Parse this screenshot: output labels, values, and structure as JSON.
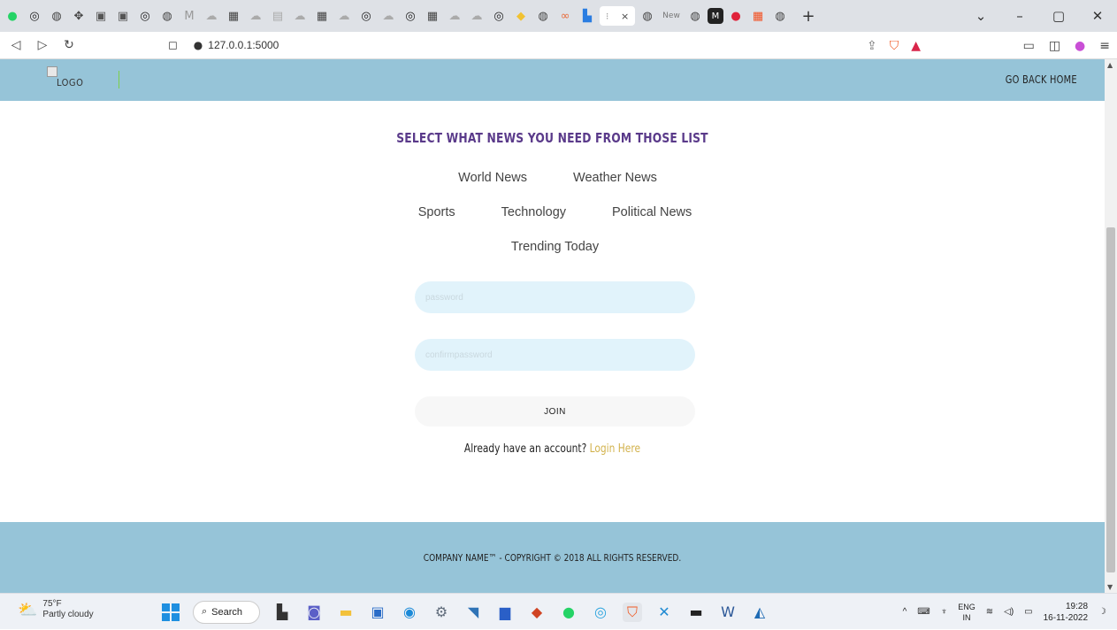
{
  "browser": {
    "url": "127.0.0.1:5000",
    "active_tab_close": "×",
    "tab_icons": [
      "whatsapp-icon",
      "github-icon",
      "globe-icon",
      "extension-icon",
      "v-icon",
      "v-icon",
      "github-icon",
      "globe-icon",
      "gmail-icon",
      "cloud-icon",
      "grid-icon",
      "cloud-icon",
      "doc-icon",
      "cloud-icon",
      "grid-icon",
      "cloud-icon",
      "github-icon",
      "cloud-icon",
      "github-icon",
      "grid-icon",
      "cloud-icon",
      "cloud-icon",
      "github-icon",
      "python-icon",
      "globe-icon",
      "link-icon",
      "bar-icon"
    ],
    "tabs_after_active": [
      "New"
    ],
    "new_tab_label": "+",
    "window_controls": [
      "⌄",
      "–",
      "▢",
      "✕"
    ]
  },
  "site": {
    "logo_alt": "LOGO",
    "nav_home": "GO BACK HOME",
    "title": "SELECT WHAT NEWS YOU NEED FROM THOSE LIST",
    "news_row1": [
      "World News",
      "Weather News"
    ],
    "news_row2": [
      "Sports",
      "Technology",
      "Political News"
    ],
    "news_row3": [
      "Trending Today"
    ],
    "password_placeholder": "password",
    "confirm_placeholder": "confirmpassword",
    "join_label": "JOIN",
    "login_prompt": "Already have an account?",
    "login_link": "Login Here",
    "footer": "COMPANY NAME™ - COPYRIGHT © 2018 ALL RIGHTS RESERVED."
  },
  "taskbar": {
    "temperature": "75°F",
    "weather": "Partly cloudy",
    "search": "Search",
    "lang_top": "ENG",
    "lang_bottom": "IN",
    "time": "19:28",
    "date": "16-11-2022"
  }
}
